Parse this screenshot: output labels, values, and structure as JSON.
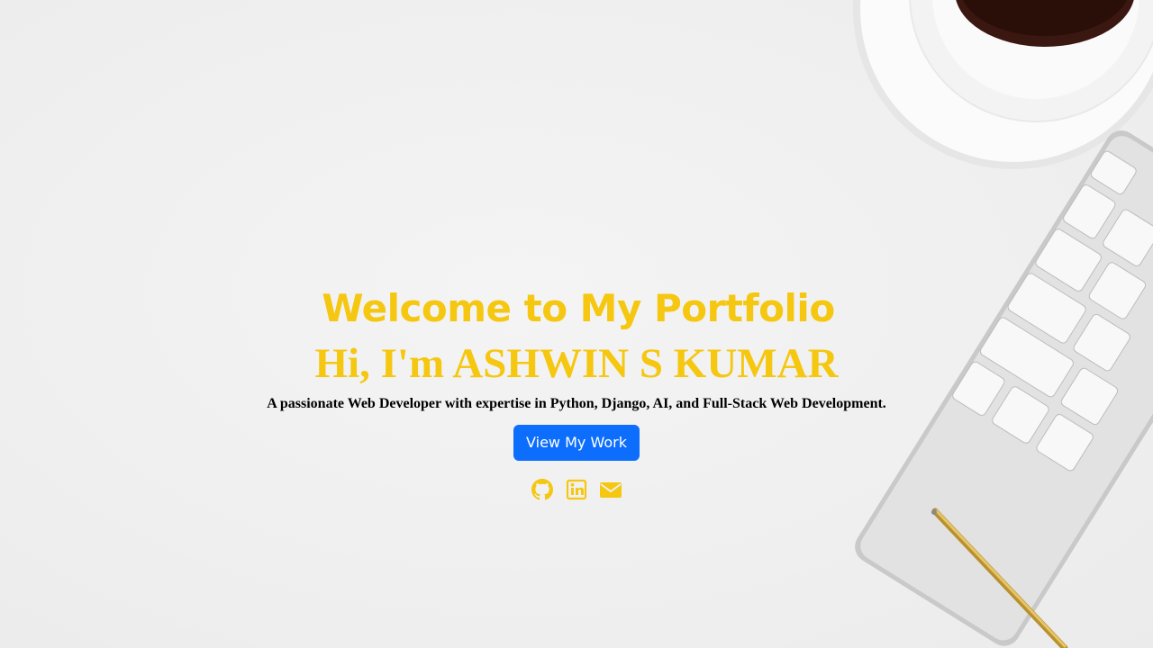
{
  "hero": {
    "title": "Welcome to My Portfolio",
    "subtitle": "Hi, I'm ASHWIN S KUMAR",
    "tagline": "A passionate Web Developer with expertise in Python, Django, AI, and Full-Stack Web Development.",
    "cta_label": "View My Work"
  },
  "social": [
    {
      "icon": "github-icon"
    },
    {
      "icon": "linkedin-icon"
    },
    {
      "icon": "envelope-icon"
    }
  ],
  "colors": {
    "accent": "#f5c710",
    "button": "#0d6efd",
    "background": "#efefef"
  }
}
